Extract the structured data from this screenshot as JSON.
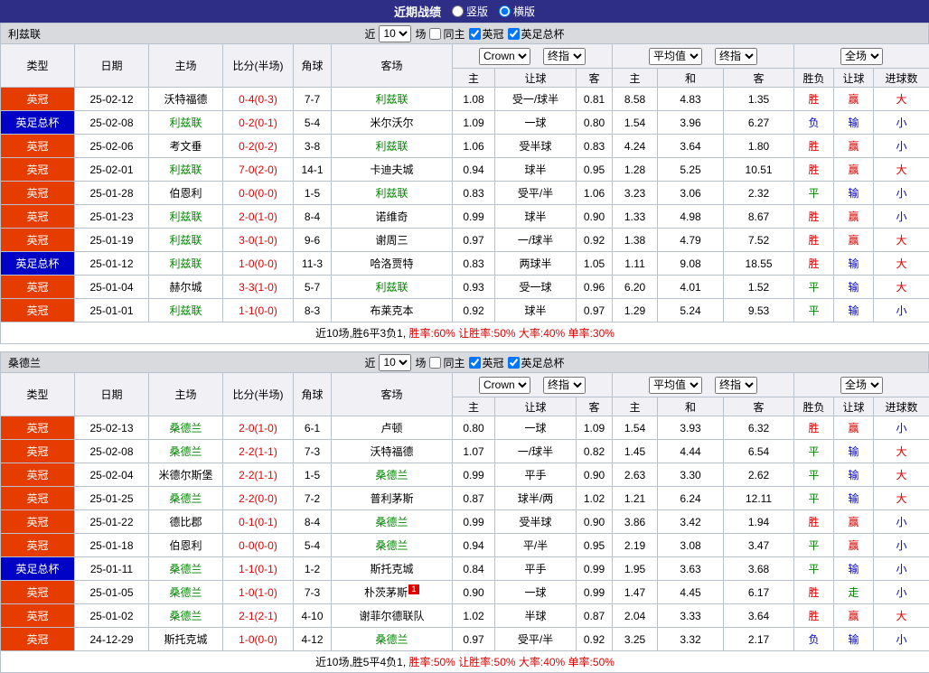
{
  "topbar": {
    "title": "近期战绩",
    "radio_vertical": "竖版",
    "radio_horizontal": "横版",
    "selected": "横版"
  },
  "filter": {
    "near_label": "近",
    "count": "10",
    "games_label": "场",
    "checkboxes": [
      {
        "label": "同主",
        "checked": false
      },
      {
        "label": "英冠",
        "checked": true
      },
      {
        "label": "英足总杯",
        "checked": true
      }
    ]
  },
  "table_header": {
    "main_cols": [
      "类型",
      "日期",
      "主场",
      "比分(半场)",
      "角球",
      "客场"
    ],
    "group1": {
      "selects": [
        "Crown",
        "终指"
      ],
      "cols": [
        "主",
        "让球",
        "客"
      ]
    },
    "group2": {
      "selects": [
        "平均值",
        "终指"
      ],
      "cols": [
        "主",
        "和",
        "客"
      ]
    },
    "group3": {
      "selects": [
        "全场"
      ],
      "cols": [
        "胜负",
        "让球",
        "进球数"
      ]
    }
  },
  "colors": {
    "topbar_bg": "#2e2e87",
    "league": {
      "英冠": "#e63c00",
      "英足总杯": "#0003c6"
    },
    "focus_team": "#008600",
    "score": "#e00000",
    "rates": "#e00000",
    "badge": "#e00000",
    "result": {
      "胜": "#e00000",
      "平": "#008600",
      "负": "#0000d8",
      "赢": "#e00000",
      "输": "#0000d8",
      "走": "#008600",
      "大": "#e00000",
      "小": "#0000d8"
    }
  },
  "sections": [
    {
      "team": "利兹联",
      "summary": {
        "record": "近10场,胜6平3负1,",
        "rates": "胜率:60% 让胜率:50% 大率:40% 单率:30%"
      },
      "rows": [
        {
          "league": "英冠",
          "date": "25-02-12",
          "home": "沃特福德",
          "home_focus": false,
          "score": "0-4(0-3)",
          "corners": "7-7",
          "away": "利兹联",
          "away_focus": true,
          "asian": {
            "home": "1.08",
            "handicap": "受一/球半",
            "away": "0.81"
          },
          "euro": {
            "home": "8.58",
            "draw": "4.83",
            "away": "1.35"
          },
          "results": {
            "outcome": "胜",
            "handicap": "赢",
            "goals": "大"
          }
        },
        {
          "league": "英足总杯",
          "date": "25-02-08",
          "home": "利兹联",
          "home_focus": true,
          "score": "0-2(0-1)",
          "corners": "5-4",
          "away": "米尔沃尔",
          "away_focus": false,
          "asian": {
            "home": "1.09",
            "handicap": "一球",
            "away": "0.80"
          },
          "euro": {
            "home": "1.54",
            "draw": "3.96",
            "away": "6.27"
          },
          "results": {
            "outcome": "负",
            "handicap": "输",
            "goals": "小"
          }
        },
        {
          "league": "英冠",
          "date": "25-02-06",
          "home": "考文垂",
          "home_focus": false,
          "score": "0-2(0-2)",
          "corners": "3-8",
          "away": "利兹联",
          "away_focus": true,
          "asian": {
            "home": "1.06",
            "handicap": "受半球",
            "away": "0.83"
          },
          "euro": {
            "home": "4.24",
            "draw": "3.64",
            "away": "1.80"
          },
          "results": {
            "outcome": "胜",
            "handicap": "赢",
            "goals": "小"
          }
        },
        {
          "league": "英冠",
          "date": "25-02-01",
          "home": "利兹联",
          "home_focus": true,
          "score": "7-0(2-0)",
          "corners": "14-1",
          "away": "卡迪夫城",
          "away_focus": false,
          "asian": {
            "home": "0.94",
            "handicap": "球半",
            "away": "0.95"
          },
          "euro": {
            "home": "1.28",
            "draw": "5.25",
            "away": "10.51"
          },
          "results": {
            "outcome": "胜",
            "handicap": "赢",
            "goals": "大"
          }
        },
        {
          "league": "英冠",
          "date": "25-01-28",
          "home": "伯恩利",
          "home_focus": false,
          "score": "0-0(0-0)",
          "corners": "1-5",
          "away": "利兹联",
          "away_focus": true,
          "asian": {
            "home": "0.83",
            "handicap": "受平/半",
            "away": "1.06"
          },
          "euro": {
            "home": "3.23",
            "draw": "3.06",
            "away": "2.32"
          },
          "results": {
            "outcome": "平",
            "handicap": "输",
            "goals": "小"
          }
        },
        {
          "league": "英冠",
          "date": "25-01-23",
          "home": "利兹联",
          "home_focus": true,
          "score": "2-0(1-0)",
          "corners": "8-4",
          "away": "诺维奇",
          "away_focus": false,
          "asian": {
            "home": "0.99",
            "handicap": "球半",
            "away": "0.90"
          },
          "euro": {
            "home": "1.33",
            "draw": "4.98",
            "away": "8.67"
          },
          "results": {
            "outcome": "胜",
            "handicap": "赢",
            "goals": "小"
          }
        },
        {
          "league": "英冠",
          "date": "25-01-19",
          "home": "利兹联",
          "home_focus": true,
          "score": "3-0(1-0)",
          "corners": "9-6",
          "away": "谢周三",
          "away_focus": false,
          "asian": {
            "home": "0.97",
            "handicap": "一/球半",
            "away": "0.92"
          },
          "euro": {
            "home": "1.38",
            "draw": "4.79",
            "away": "7.52"
          },
          "results": {
            "outcome": "胜",
            "handicap": "赢",
            "goals": "大"
          }
        },
        {
          "league": "英足总杯",
          "date": "25-01-12",
          "home": "利兹联",
          "home_focus": true,
          "score": "1-0(0-0)",
          "corners": "11-3",
          "away": "哈洛贾特",
          "away_focus": false,
          "asian": {
            "home": "0.83",
            "handicap": "两球半",
            "away": "1.05"
          },
          "euro": {
            "home": "1.11",
            "draw": "9.08",
            "away": "18.55"
          },
          "results": {
            "outcome": "胜",
            "handicap": "输",
            "goals": "大"
          }
        },
        {
          "league": "英冠",
          "date": "25-01-04",
          "home": "赫尔城",
          "home_focus": false,
          "score": "3-3(1-0)",
          "corners": "5-7",
          "away": "利兹联",
          "away_focus": true,
          "asian": {
            "home": "0.93",
            "handicap": "受一球",
            "away": "0.96"
          },
          "euro": {
            "home": "6.20",
            "draw": "4.01",
            "away": "1.52"
          },
          "results": {
            "outcome": "平",
            "handicap": "输",
            "goals": "大"
          }
        },
        {
          "league": "英冠",
          "date": "25-01-01",
          "home": "利兹联",
          "home_focus": true,
          "score": "1-1(0-0)",
          "corners": "8-3",
          "away": "布莱克本",
          "away_focus": false,
          "asian": {
            "home": "0.92",
            "handicap": "球半",
            "away": "0.97"
          },
          "euro": {
            "home": "1.29",
            "draw": "5.24",
            "away": "9.53"
          },
          "results": {
            "outcome": "平",
            "handicap": "输",
            "goals": "小"
          }
        }
      ]
    },
    {
      "team": "桑德兰",
      "summary": {
        "record": "近10场,胜5平4负1,",
        "rates": "胜率:50% 让胜率:50% 大率:40% 单率:50%"
      },
      "rows": [
        {
          "league": "英冠",
          "date": "25-02-13",
          "home": "桑德兰",
          "home_focus": true,
          "score": "2-0(1-0)",
          "corners": "6-1",
          "away": "卢顿",
          "away_focus": false,
          "asian": {
            "home": "0.80",
            "handicap": "一球",
            "away": "1.09"
          },
          "euro": {
            "home": "1.54",
            "draw": "3.93",
            "away": "6.32"
          },
          "results": {
            "outcome": "胜",
            "handicap": "赢",
            "goals": "小"
          }
        },
        {
          "league": "英冠",
          "date": "25-02-08",
          "home": "桑德兰",
          "home_focus": true,
          "score": "2-2(1-1)",
          "corners": "7-3",
          "away": "沃特福德",
          "away_focus": false,
          "asian": {
            "home": "1.07",
            "handicap": "一/球半",
            "away": "0.82"
          },
          "euro": {
            "home": "1.45",
            "draw": "4.44",
            "away": "6.54"
          },
          "results": {
            "outcome": "平",
            "handicap": "输",
            "goals": "大"
          }
        },
        {
          "league": "英冠",
          "date": "25-02-04",
          "home": "米德尔斯堡",
          "home_focus": false,
          "score": "2-2(1-1)",
          "corners": "1-5",
          "away": "桑德兰",
          "away_focus": true,
          "asian": {
            "home": "0.99",
            "handicap": "平手",
            "away": "0.90"
          },
          "euro": {
            "home": "2.63",
            "draw": "3.30",
            "away": "2.62"
          },
          "results": {
            "outcome": "平",
            "handicap": "输",
            "goals": "大"
          }
        },
        {
          "league": "英冠",
          "date": "25-01-25",
          "home": "桑德兰",
          "home_focus": true,
          "score": "2-2(0-0)",
          "corners": "7-2",
          "away": "普利茅斯",
          "away_focus": false,
          "asian": {
            "home": "0.87",
            "handicap": "球半/两",
            "away": "1.02"
          },
          "euro": {
            "home": "1.21",
            "draw": "6.24",
            "away": "12.11"
          },
          "results": {
            "outcome": "平",
            "handicap": "输",
            "goals": "大"
          }
        },
        {
          "league": "英冠",
          "date": "25-01-22",
          "home": "德比郡",
          "home_focus": false,
          "score": "0-1(0-1)",
          "corners": "8-4",
          "away": "桑德兰",
          "away_focus": true,
          "asian": {
            "home": "0.99",
            "handicap": "受半球",
            "away": "0.90"
          },
          "euro": {
            "home": "3.86",
            "draw": "3.42",
            "away": "1.94"
          },
          "results": {
            "outcome": "胜",
            "handicap": "赢",
            "goals": "小"
          }
        },
        {
          "league": "英冠",
          "date": "25-01-18",
          "home": "伯恩利",
          "home_focus": false,
          "score": "0-0(0-0)",
          "corners": "5-4",
          "away": "桑德兰",
          "away_focus": true,
          "asian": {
            "home": "0.94",
            "handicap": "平/半",
            "away": "0.95"
          },
          "euro": {
            "home": "2.19",
            "draw": "3.08",
            "away": "3.47"
          },
          "results": {
            "outcome": "平",
            "handicap": "赢",
            "goals": "小"
          }
        },
        {
          "league": "英足总杯",
          "date": "25-01-11",
          "home": "桑德兰",
          "home_focus": true,
          "score": "1-1(0-1)",
          "corners": "1-2",
          "away": "斯托克城",
          "away_focus": false,
          "asian": {
            "home": "0.84",
            "handicap": "平手",
            "away": "0.99"
          },
          "euro": {
            "home": "1.95",
            "draw": "3.63",
            "away": "3.68"
          },
          "results": {
            "outcome": "平",
            "handicap": "输",
            "goals": "小"
          }
        },
        {
          "league": "英冠",
          "date": "25-01-05",
          "home": "桑德兰",
          "home_focus": true,
          "score": "1-0(1-0)",
          "corners": "7-3",
          "away": "朴茨茅斯",
          "away_focus": false,
          "away_badge": "1",
          "asian": {
            "home": "0.90",
            "handicap": "一球",
            "away": "0.99"
          },
          "euro": {
            "home": "1.47",
            "draw": "4.45",
            "away": "6.17"
          },
          "results": {
            "outcome": "胜",
            "handicap": "走",
            "goals": "小"
          }
        },
        {
          "league": "英冠",
          "date": "25-01-02",
          "home": "桑德兰",
          "home_focus": true,
          "score": "2-1(2-1)",
          "corners": "4-10",
          "away": "谢菲尔德联队",
          "away_focus": false,
          "asian": {
            "home": "1.02",
            "handicap": "半球",
            "away": "0.87"
          },
          "euro": {
            "home": "2.04",
            "draw": "3.33",
            "away": "3.64"
          },
          "results": {
            "outcome": "胜",
            "handicap": "赢",
            "goals": "大"
          }
        },
        {
          "league": "英冠",
          "date": "24-12-29",
          "home": "斯托克城",
          "home_focus": false,
          "score": "1-0(0-0)",
          "corners": "4-12",
          "away": "桑德兰",
          "away_focus": true,
          "asian": {
            "home": "0.97",
            "handicap": "受平/半",
            "away": "0.92"
          },
          "euro": {
            "home": "3.25",
            "draw": "3.32",
            "away": "2.17"
          },
          "results": {
            "outcome": "负",
            "handicap": "输",
            "goals": "小"
          }
        }
      ]
    }
  ]
}
